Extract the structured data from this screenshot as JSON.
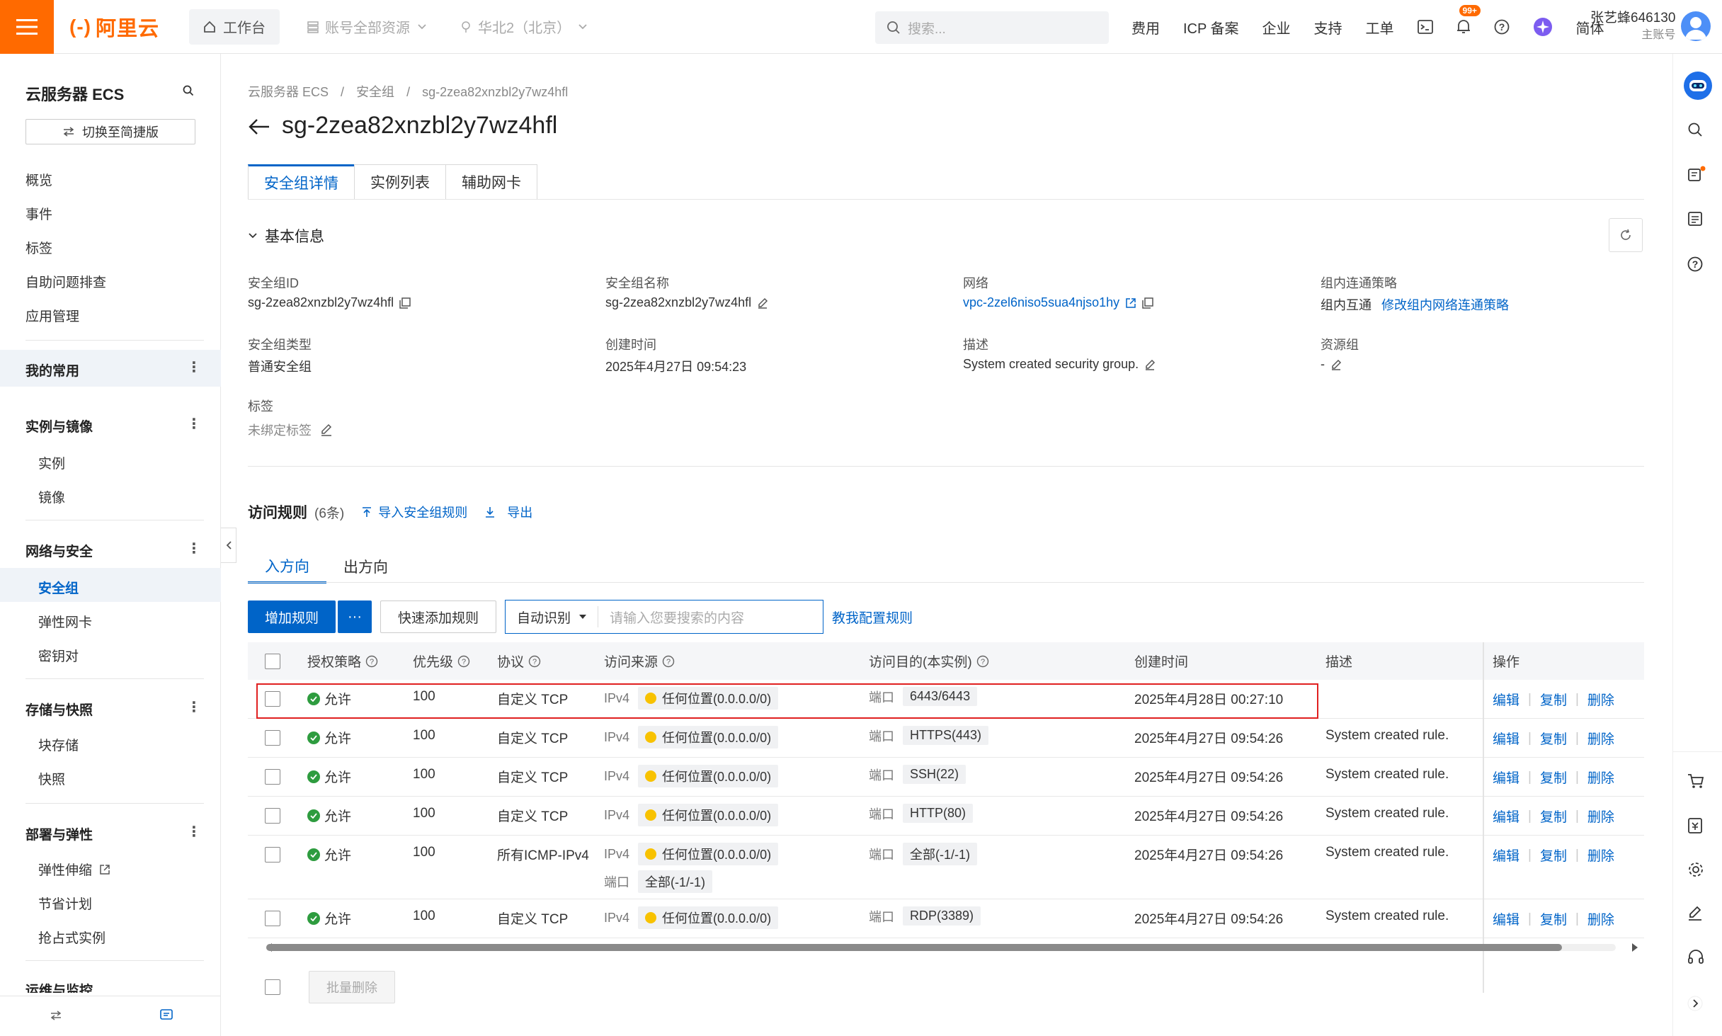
{
  "topbar": {
    "logo": "阿里云",
    "workbench": "工作台",
    "resources": "账号全部资源",
    "region": "华北2（北京）",
    "search_placeholder": "搜索...",
    "links": [
      "费用",
      "ICP 备案",
      "企业",
      "支持",
      "工单"
    ],
    "notify_badge": "99+",
    "lang": "简体",
    "user_name": "张艺蜂646130",
    "user_role": "主账号",
    "brand_color": "#ff6a00"
  },
  "sidebar": {
    "title": "云服务器 ECS",
    "switch_label": "切换至简捷版",
    "top_items": [
      "概览",
      "事件",
      "标签",
      "自助问题排查",
      "应用管理"
    ],
    "favorites": "我的常用",
    "groups": [
      {
        "title": "实例与镜像",
        "items": [
          "实例",
          "镜像"
        ]
      },
      {
        "title": "网络与安全",
        "items": [
          "安全组",
          "弹性网卡",
          "密钥对"
        ]
      },
      {
        "title": "存储与快照",
        "items": [
          "块存储",
          "快照"
        ]
      },
      {
        "title": "部署与弹性",
        "items": [
          "弹性伸缩",
          "节省计划",
          "抢占式实例"
        ]
      },
      {
        "title": "运维与监控",
        "items": []
      }
    ],
    "active_item": "安全组"
  },
  "breadcrumb": [
    "云服务器 ECS",
    "/",
    "安全组",
    "/",
    "sg-2zea82xnzbl2y7wz4hfl"
  ],
  "page_title": "sg-2zea82xnzbl2y7wz4hfl",
  "tabs": [
    "安全组详情",
    "实例列表",
    "辅助网卡"
  ],
  "basic_info": {
    "title": "基本信息",
    "fields": {
      "sg_id_label": "安全组ID",
      "sg_id": "sg-2zea82xnzbl2y7wz4hfl",
      "sg_name_label": "安全组名称",
      "sg_name": "sg-2zea82xnzbl2y7wz4hfl",
      "network_label": "网络",
      "network": "vpc-2zel6niso5sua4njso1hy",
      "policy_label": "组内连通策略",
      "policy": "组内互通",
      "policy_link": "修改组内网络连通策略",
      "type_label": "安全组类型",
      "type": "普通安全组",
      "created_label": "创建时间",
      "created": "2025年4月27日 09:54:23",
      "desc_label": "描述",
      "desc": "System created security group.",
      "rg_label": "资源组",
      "rg": "-",
      "tags_label": "标签",
      "tags": "未绑定标签"
    }
  },
  "rules": {
    "title": "访问规则",
    "count": "(6条)",
    "import": "导入安全组规则",
    "export": "导出",
    "directions": [
      "入方向",
      "出方向"
    ],
    "add_button": "增加规则",
    "more_button": "···",
    "quick_add": "快速添加规则",
    "search_mode": "自动识别",
    "search_placeholder": "请输入您要搜索的内容",
    "help_link": "教我配置规则",
    "columns": [
      "授权策略",
      "优先级",
      "协议",
      "访问来源",
      "访问目的(本实例)",
      "创建时间",
      "描述",
      "操作"
    ],
    "rows": [
      {
        "policy": "允许",
        "priority": "100",
        "protocol": "自定义 TCP",
        "src_type": "IPv4",
        "src": "任何位置(0.0.0.0/0)",
        "dst_label": "端口",
        "dst": "6443/6443",
        "created": "2025年4月28日 00:27:10",
        "desc": ""
      },
      {
        "policy": "允许",
        "priority": "100",
        "protocol": "自定义 TCP",
        "src_type": "IPv4",
        "src": "任何位置(0.0.0.0/0)",
        "dst_label": "端口",
        "dst": "HTTPS(443)",
        "created": "2025年4月27日 09:54:26",
        "desc": "System created rule."
      },
      {
        "policy": "允许",
        "priority": "100",
        "protocol": "自定义 TCP",
        "src_type": "IPv4",
        "src": "任何位置(0.0.0.0/0)",
        "dst_label": "端口",
        "dst": "SSH(22)",
        "created": "2025年4月27日 09:54:26",
        "desc": "System created rule."
      },
      {
        "policy": "允许",
        "priority": "100",
        "protocol": "自定义 TCP",
        "src_type": "IPv4",
        "src": "任何位置(0.0.0.0/0)",
        "dst_label": "端口",
        "dst": "HTTP(80)",
        "created": "2025年4月27日 09:54:26",
        "desc": "System created rule."
      },
      {
        "policy": "允许",
        "priority": "100",
        "protocol": "所有ICMP-IPv4",
        "src_type": "IPv4",
        "src": "任何位置(0.0.0.0/0)",
        "src_extra_label": "端口",
        "src_extra": "全部(-1/-1)",
        "dst_label": "端口",
        "dst": "全部(-1/-1)",
        "created": "2025年4月27日 09:54:26",
        "desc": "System created rule."
      },
      {
        "policy": "允许",
        "priority": "100",
        "protocol": "自定义 TCP",
        "src_type": "IPv4",
        "src": "任何位置(0.0.0.0/0)",
        "dst_label": "端口",
        "dst": "RDP(3389)",
        "created": "2025年4月27日 09:54:26",
        "desc": "System created rule."
      }
    ],
    "ops": [
      "编辑",
      "复制",
      "删除"
    ],
    "bulk_delete": "批量删除"
  }
}
